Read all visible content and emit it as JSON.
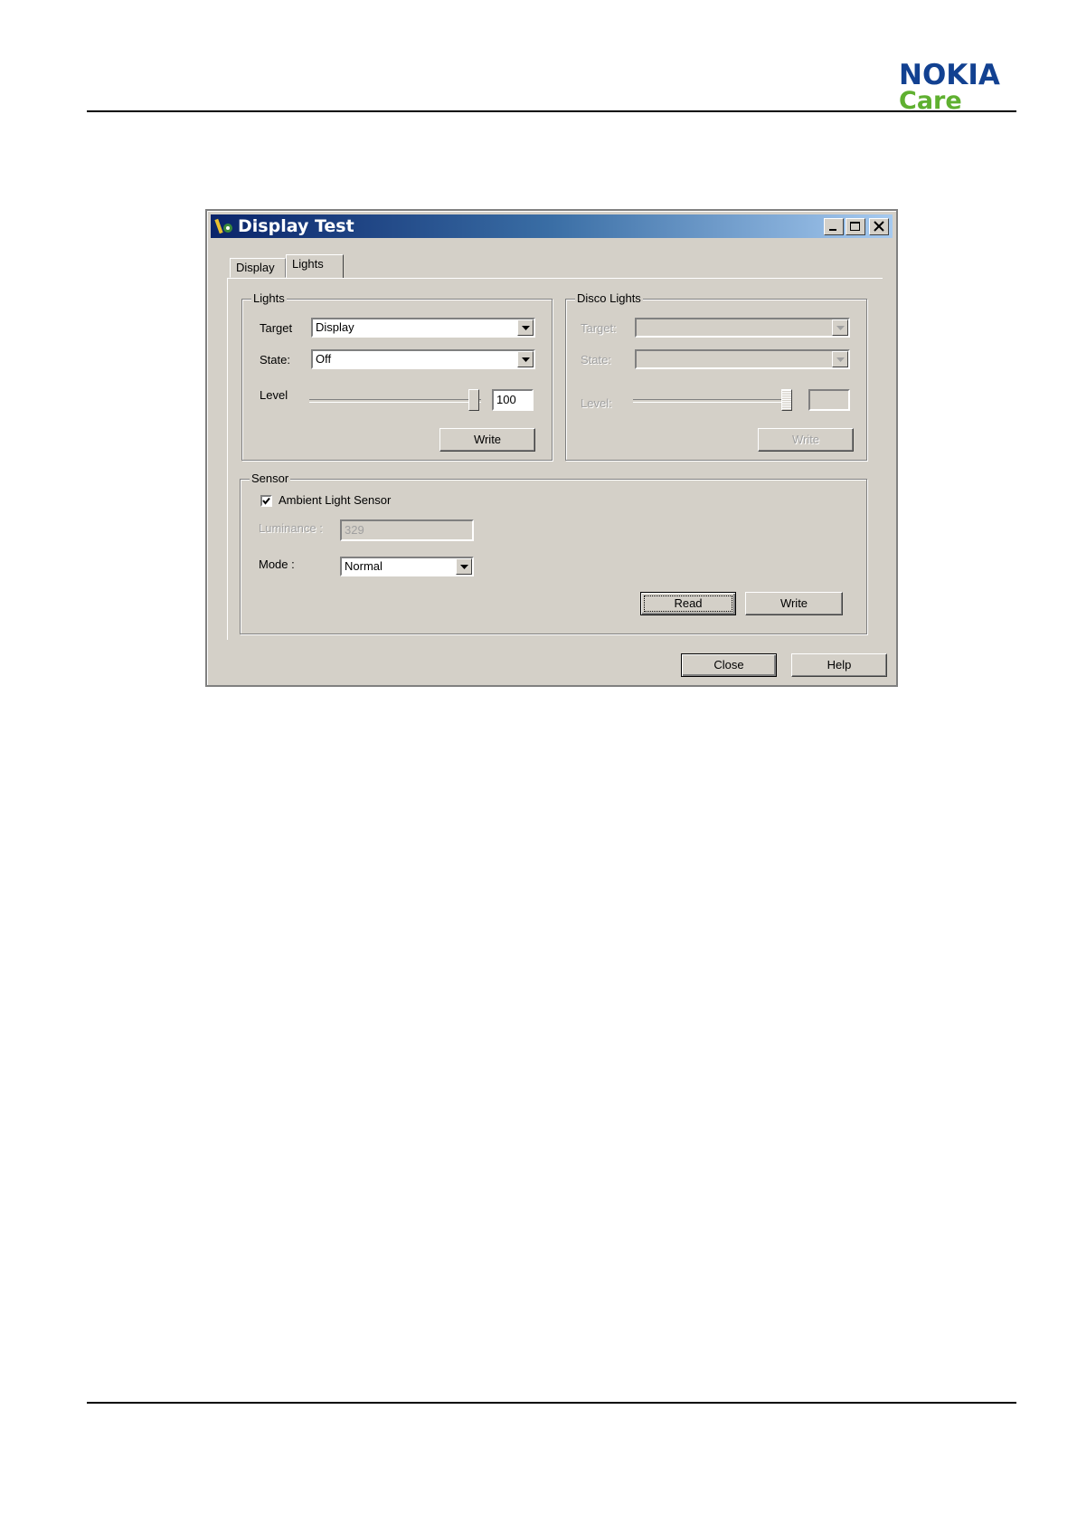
{
  "header": {
    "brand": "NOKIA",
    "brand_sub": "Care"
  },
  "window": {
    "title": "Display Test",
    "tabs": [
      {
        "label": "Display"
      },
      {
        "label": "Lights"
      }
    ]
  },
  "lights": {
    "group_label": "Lights",
    "target_label": "Target",
    "target_value": "Display",
    "state_label": "State:",
    "state_value": "Off",
    "level_label": "Level",
    "level_value": "100",
    "write_label": "Write"
  },
  "disco_lights": {
    "group_label": "Disco Lights",
    "target_label": "Target:",
    "state_label": "State:",
    "level_label": "Level:",
    "write_label": "Write"
  },
  "sensor": {
    "group_label": "Sensor",
    "ambient_label": "Ambient Light Sensor",
    "ambient_checked": true,
    "luminance_label": "Luminance :",
    "luminance_value": "329",
    "mode_label": "Mode :",
    "mode_value": "Normal",
    "read_label": "Read",
    "write_label": "Write"
  },
  "footer": {
    "close_label": "Close",
    "help_label": "Help"
  },
  "colors": {
    "nokia_blue": "#124191",
    "care_green": "#5fb030",
    "titlebar": "#0a246a",
    "face": "#d4d0c8"
  }
}
